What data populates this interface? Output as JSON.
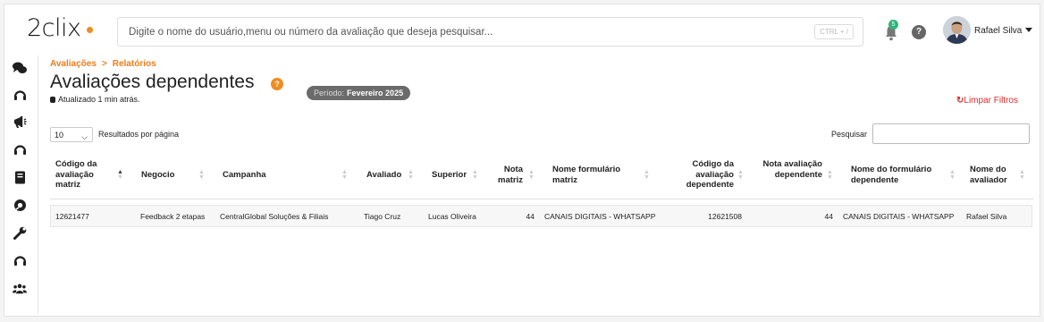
{
  "header": {
    "logo_text": "2clix",
    "search_placeholder": "Digite o nome do usuário,menu ou número da avaliação que deseja pesquisar...",
    "search_shortcut": "CTRL + /",
    "notification_count": "5",
    "help_label": "?",
    "user_name": "Rafael Silva"
  },
  "sidebar": {
    "items": [
      {
        "icon": "chat-bubbles-icon"
      },
      {
        "icon": "headset-icon"
      },
      {
        "icon": "megaphone-icon"
      },
      {
        "icon": "headset-icon"
      },
      {
        "icon": "book-icon"
      },
      {
        "icon": "support-ring-icon"
      },
      {
        "icon": "wrench-icon"
      },
      {
        "icon": "headset-icon"
      },
      {
        "icon": "team-icon"
      }
    ]
  },
  "page": {
    "breadcrumb": [
      "Avaliações",
      ">",
      "Relatórios"
    ],
    "title": "Avaliações dependentes",
    "title_help": "?",
    "updated": "Atualizado 1 min atrás.",
    "period_label": "Período:",
    "period_value": "Fevereiro 2025",
    "clear_filters": "Limpar Filtros",
    "per_page_value": "10",
    "per_page_label": "Resultados por página",
    "search_label": "Pesquisar"
  },
  "table": {
    "columns": [
      "Código da avaliação matriz",
      "Negocio",
      "Campanha",
      "Avaliado",
      "Superior",
      "Nota matriz",
      "Nome formulário matriz",
      "Código da avaliação dependente",
      "Nota avaliação dependente",
      "Nome do formulário dependente",
      "Nome do avaliador"
    ],
    "rows": [
      [
        "12621477",
        "Feedback 2 etapas",
        "CentralGlobal Soluções & Filiais",
        "Tiago Cruz",
        "Lucas Oliveira",
        "44",
        "CANAIS DIGITAIS - WHATSAPP",
        "12621508",
        "44",
        "CANAIS DIGITAIS - WHATSAPP",
        "Rafael Silva"
      ]
    ]
  },
  "colors": {
    "accent": "#f07c1b",
    "danger": "#e12a2a",
    "badge": "#2fb57a"
  }
}
